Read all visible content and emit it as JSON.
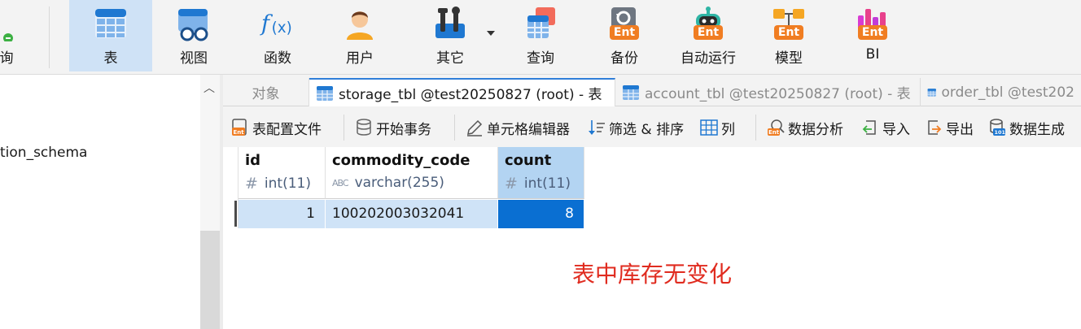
{
  "ribbon": {
    "left_partial_label": "询",
    "buttons": [
      {
        "id": "table",
        "label": "表",
        "active": true
      },
      {
        "id": "view",
        "label": "视图"
      },
      {
        "id": "function",
        "label": "函数"
      },
      {
        "id": "user",
        "label": "用户"
      },
      {
        "id": "other",
        "label": "其它"
      },
      {
        "id": "query",
        "label": "查询"
      },
      {
        "id": "backup",
        "label": "备份"
      },
      {
        "id": "automation",
        "label": "自动运行"
      },
      {
        "id": "model",
        "label": "模型"
      },
      {
        "id": "bi",
        "label": "BI"
      }
    ],
    "ent_badge": "Ent",
    "function_glyph": "f(x)"
  },
  "nav": {
    "schema_item": "tion_schema"
  },
  "tabs": [
    {
      "label": "对象",
      "active": false
    },
    {
      "label": "storage_tbl @test20250827 (root) - 表",
      "active": true
    },
    {
      "label": "account_tbl @test20250827 (root) - 表",
      "active": false
    },
    {
      "label": "order_tbl @test202",
      "active": false
    }
  ],
  "toolbar": [
    {
      "label": "表配置文件",
      "icon": "table-profile-icon"
    },
    {
      "label": "开始事务",
      "icon": "database-icon"
    },
    {
      "label": "单元格编辑器",
      "icon": "pencil-icon"
    },
    {
      "label": "筛选 & 排序",
      "icon": "filter-sort-icon"
    },
    {
      "label": "列",
      "icon": "columns-icon"
    },
    {
      "label": "数据分析",
      "icon": "data-analysis-icon"
    },
    {
      "label": "导入",
      "icon": "import-icon"
    },
    {
      "label": "导出",
      "icon": "export-icon"
    },
    {
      "label": "数据生成",
      "icon": "data-generate-icon"
    }
  ],
  "grid": {
    "columns": [
      {
        "name": "id",
        "type_mark": "#",
        "type": "int(11)"
      },
      {
        "name": "commodity_code",
        "type_mark": "ABC",
        "type": "varchar(255)"
      },
      {
        "name": "count",
        "type_mark": "#",
        "type": "int(11)"
      }
    ],
    "rows": [
      {
        "id": "1",
        "commodity_code": "100202003032041",
        "count": "8"
      }
    ]
  },
  "annotation": "表中库存无变化",
  "colors": {
    "accent": "#0a6fd2",
    "selection": "#cfe3f7",
    "annotation": "#e02b1f",
    "ent_badge": "#f07d22"
  }
}
